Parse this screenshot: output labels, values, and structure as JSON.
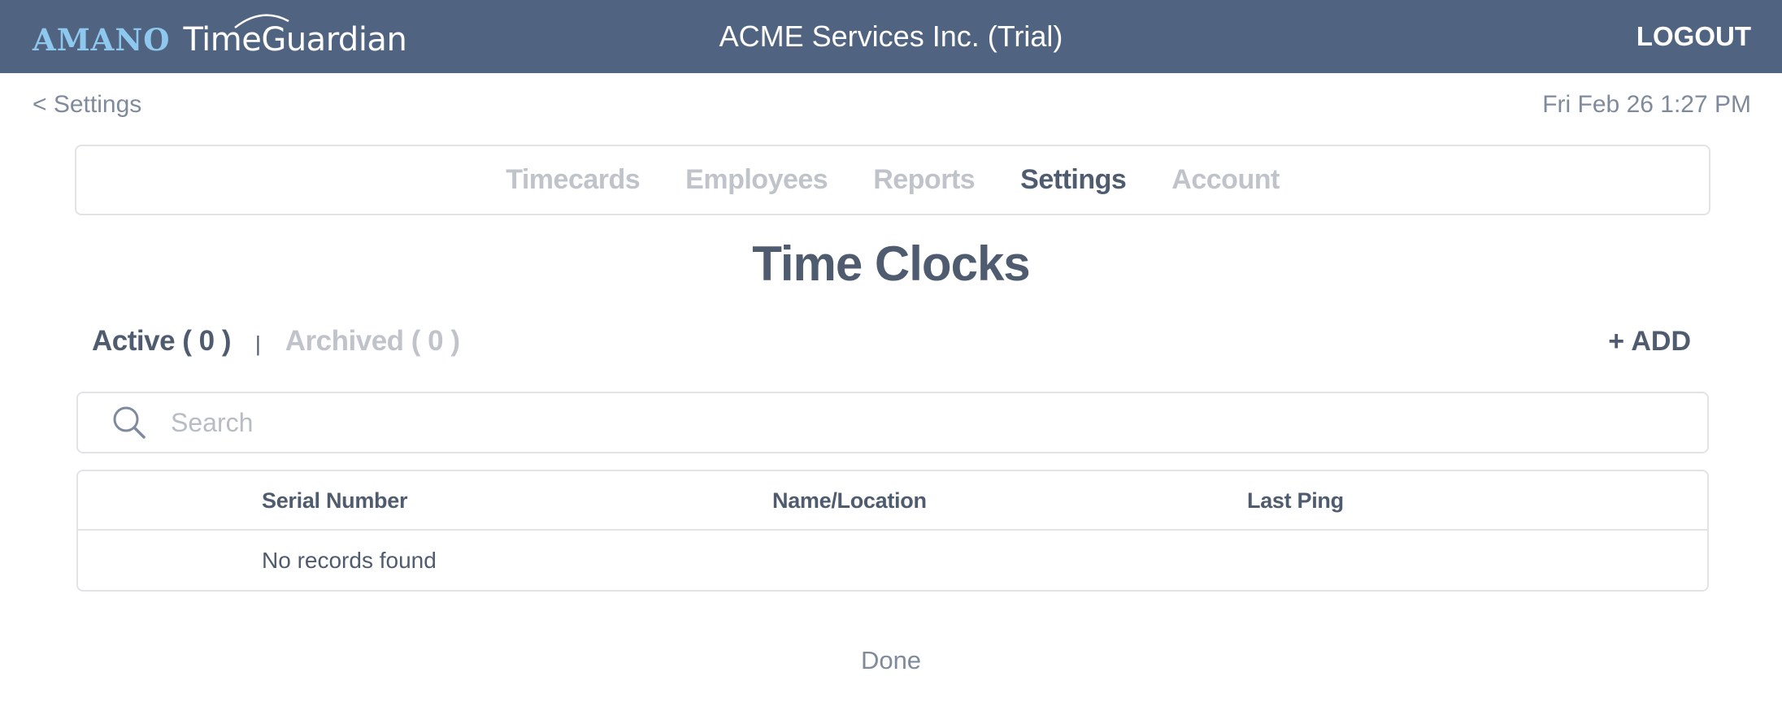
{
  "header": {
    "logo_brand": "AMANO",
    "logo_product": "TimeGuardian",
    "company_name": "ACME Services Inc. (Trial)",
    "logout_label": "LOGOUT",
    "background_color": "#506482"
  },
  "subheader": {
    "back_link_label": "< Settings",
    "datetime": "Fri Feb 26 1:27 PM"
  },
  "nav": {
    "items": [
      {
        "label": "Timecards",
        "active": false
      },
      {
        "label": "Employees",
        "active": false
      },
      {
        "label": "Reports",
        "active": false
      },
      {
        "label": "Settings",
        "active": true
      },
      {
        "label": "Account",
        "active": false
      }
    ]
  },
  "page": {
    "title": "Time Clocks"
  },
  "filters": {
    "active_label": "Active ( 0 )",
    "separator": "|",
    "archived_label": "Archived ( 0 )",
    "add_label": "+ ADD"
  },
  "search": {
    "icon": "search-icon",
    "placeholder": "Search",
    "value": ""
  },
  "table": {
    "columns": [
      "Serial Number",
      "Name/Location",
      "Last Ping"
    ],
    "rows": [],
    "empty_message": "No records found"
  },
  "footer": {
    "done_label": "Done"
  },
  "colors": {
    "primary_text": "#4f5b6e",
    "muted_text": "#7f8b9c",
    "inactive_text": "#c0c4ca",
    "border": "#e1e3e6",
    "logo_accent": "#8fc8ee"
  }
}
